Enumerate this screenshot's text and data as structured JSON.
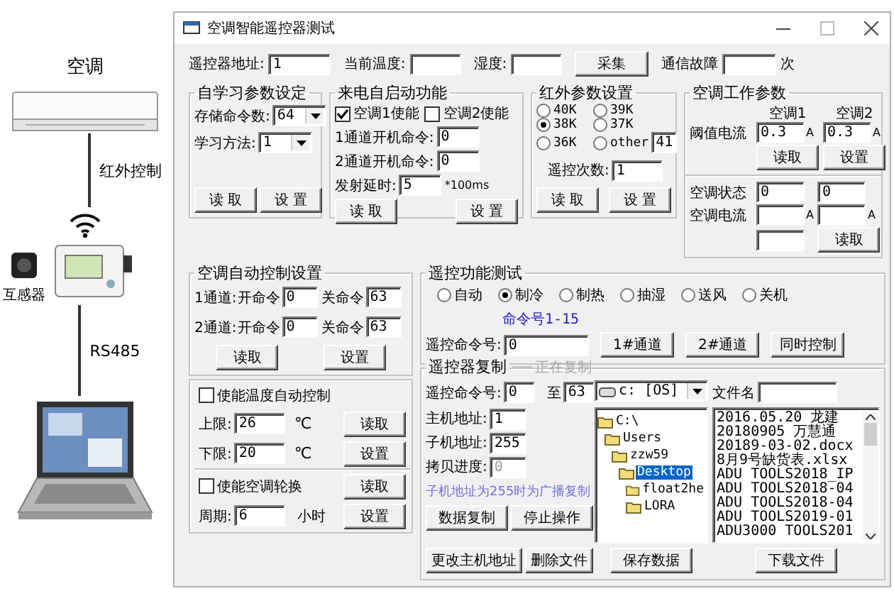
{
  "illustration": {
    "ac_label": "空调",
    "ir_label": "红外控制",
    "sensor_label": "互感器",
    "bus_label": "RS485"
  },
  "window": {
    "title": "空调智能遥控器测试"
  },
  "top_bar": {
    "address": {
      "label": "遥控器地址:",
      "value": "1"
    },
    "temperature": {
      "label": "当前温度:"
    },
    "humidity": {
      "label": "湿度:"
    },
    "collect_button": "采集",
    "fault": {
      "label": "通信故障",
      "unit": "次"
    }
  },
  "self_learning": {
    "title": "自学习参数设定",
    "dropdowns": [
      {
        "label": "存储命令数:",
        "value": "64"
      },
      {
        "label": "学习方法:",
        "value": "1"
      }
    ],
    "buttons": [
      "读 取",
      "设 置"
    ]
  },
  "power_on_start": {
    "title": "来电自启动功能",
    "checks": [
      {
        "label": "空调1使能",
        "checked": true
      },
      {
        "label": "空调2使能",
        "checked": false
      }
    ],
    "fields": [
      {
        "label": "1通道开机命令:",
        "value": "0"
      },
      {
        "label": "2通道开机命令:",
        "value": "0"
      },
      {
        "label": "发射延时:",
        "value": "5",
        "unit": "*100ms"
      }
    ],
    "buttons": [
      "读 取",
      "设 置"
    ]
  },
  "ir_params": {
    "title": "红外参数设置",
    "options": [
      {
        "label": "40K",
        "selected": false
      },
      {
        "label": "39K",
        "selected": false
      },
      {
        "label": "38K",
        "selected": true
      },
      {
        "label": "37K",
        "selected": false
      },
      {
        "label": "36K",
        "selected": false
      },
      {
        "label": "other",
        "selected": false
      }
    ],
    "other_value": "41",
    "repeat": {
      "label": "遥控次数:",
      "value": "1"
    },
    "buttons": [
      "读 取",
      "设 置"
    ]
  },
  "ac_work": {
    "title": "空调工作参数",
    "col_headers": [
      "空调1",
      "空调2"
    ],
    "threshold": {
      "label": "阈值电流",
      "values": [
        "0.3",
        "0.3"
      ],
      "units": [
        "A",
        "A"
      ]
    },
    "buttons": [
      "读取",
      "设置"
    ],
    "status": {
      "label": "空调状态",
      "values": [
        "0",
        "0"
      ]
    },
    "current": {
      "label": "空调电流",
      "units": [
        "A",
        "A"
      ]
    },
    "read_button": "读取"
  },
  "auto_control": {
    "title": "空调自动控制设置",
    "rows": [
      {
        "label": "1通道:",
        "on_label": "开命令",
        "on_value": "0",
        "off_label": "关命令",
        "off_value": "63"
      },
      {
        "label": "2通道:",
        "on_label": "开命令",
        "on_value": "0",
        "off_label": "关命令",
        "off_value": "63"
      }
    ],
    "buttons": [
      "读取",
      "设置"
    ]
  },
  "temp_control": {
    "enable": {
      "label": "使能温度自动控制",
      "checked": false
    },
    "limits": [
      {
        "label": "上限:",
        "value": "26",
        "unit": "℃",
        "button": "读取"
      },
      {
        "label": "下限:",
        "value": "20",
        "unit": "℃",
        "button": "设置"
      }
    ]
  },
  "rotation": {
    "enable": {
      "label": "使能空调轮换",
      "checked": false
    },
    "period": {
      "label": "周期:",
      "value": "6",
      "unit": "小时"
    },
    "buttons": [
      "读取",
      "设置"
    ]
  },
  "remote_test": {
    "title": "遥控功能测试",
    "modes": [
      {
        "label": "自动",
        "selected": false
      },
      {
        "label": "制冷",
        "selected": true
      },
      {
        "label": "制热",
        "selected": false
      },
      {
        "label": "抽湿",
        "selected": false
      },
      {
        "label": "送风",
        "selected": false
      },
      {
        "label": "关机",
        "selected": false
      }
    ],
    "hint": "命令号1-15",
    "command": {
      "label": "遥控命令号:",
      "value": "0"
    },
    "buttons": [
      "1#通道",
      "2#通道",
      "同时控制"
    ]
  },
  "remote_copy": {
    "title": "遥控器复制",
    "status": {
      "text": "正在复制",
      "disabled": true
    },
    "command": {
      "label": "遥控命令号:",
      "from": "0",
      "to_label": "至",
      "to": "63"
    },
    "fields": [
      {
        "label": "主机地址:",
        "value": "1",
        "disabled": false
      },
      {
        "label": "子机地址:",
        "value": "255",
        "disabled": false
      },
      {
        "label": "拷贝进度:",
        "value": "0",
        "disabled": true
      }
    ],
    "note": "子机地址为255时为广播复制",
    "buttons": [
      "数据复制",
      "停止操作",
      "更改主机地址",
      "删除文件"
    ],
    "drive": "c: [OS]",
    "filename_label": "文件名",
    "folders": [
      {
        "label": "C:\\",
        "selected": false,
        "children": [
          {
            "label": "Users",
            "selected": false,
            "children": [
              {
                "label": "zzw59",
                "selected": false,
                "children": [
                  {
                    "label": "Desktop",
                    "selected": true,
                    "children": [
                      {
                        "label": "float2he",
                        "selected": false
                      },
                      {
                        "label": "LORA",
                        "selected": false
                      }
                    ]
                  }
                ]
              }
            ]
          }
        ]
      }
    ],
    "files": [
      "2016.05.20 龙建",
      "20180905 万慧通",
      "20189-03-02.docx",
      "8月9号缺货表.xlsx",
      "ADU TOOLS2018_IP",
      "ADU TOOLS2018-04",
      "ADU TOOLS2018-04",
      "ADU TOOLS2019-01",
      "ADU3000 TOOLS201"
    ],
    "save_button": "保存数据",
    "download_button": "下载文件"
  }
}
